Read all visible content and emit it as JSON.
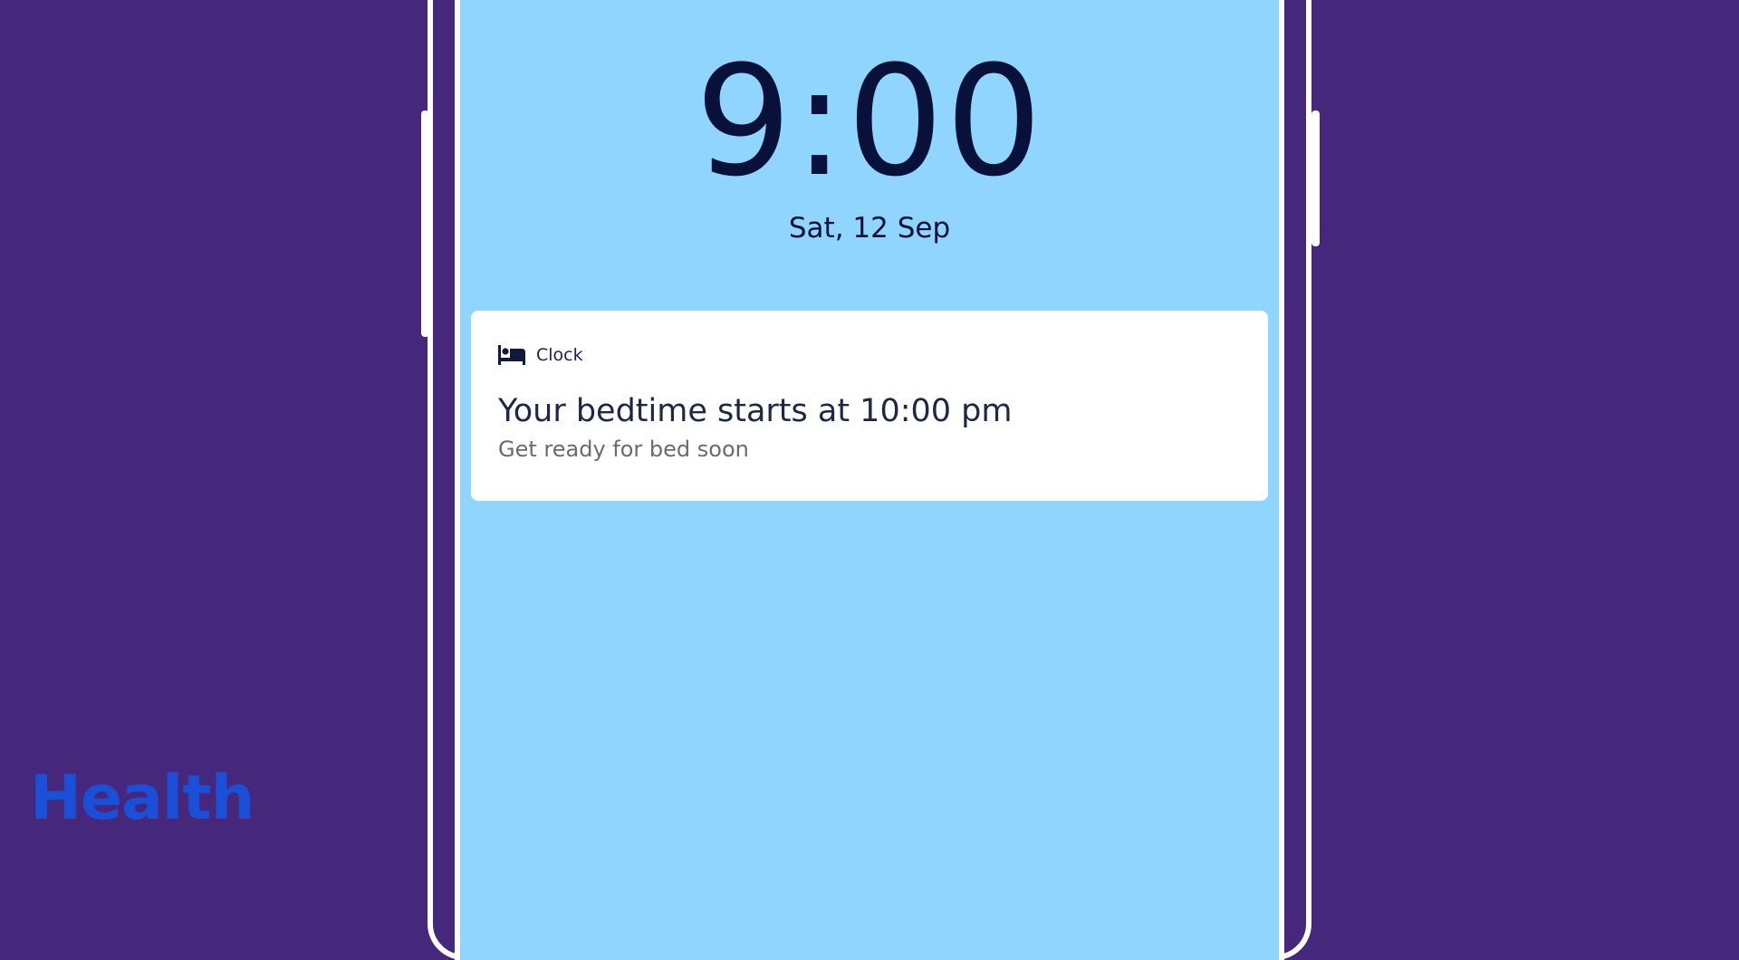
{
  "lockscreen": {
    "time": "9:00",
    "date": "Sat, 12 Sep"
  },
  "notification": {
    "app_name": "Clock",
    "app_icon": "bed-icon",
    "title": "Your bedtime starts at 10:00 pm",
    "text": "Get ready for bed soon"
  },
  "brand": {
    "name": "Health"
  },
  "colors": {
    "background": "#45287c",
    "screen": "#8fd5fe",
    "brand": "#1a4fd8",
    "text_dark": "#07113a"
  }
}
